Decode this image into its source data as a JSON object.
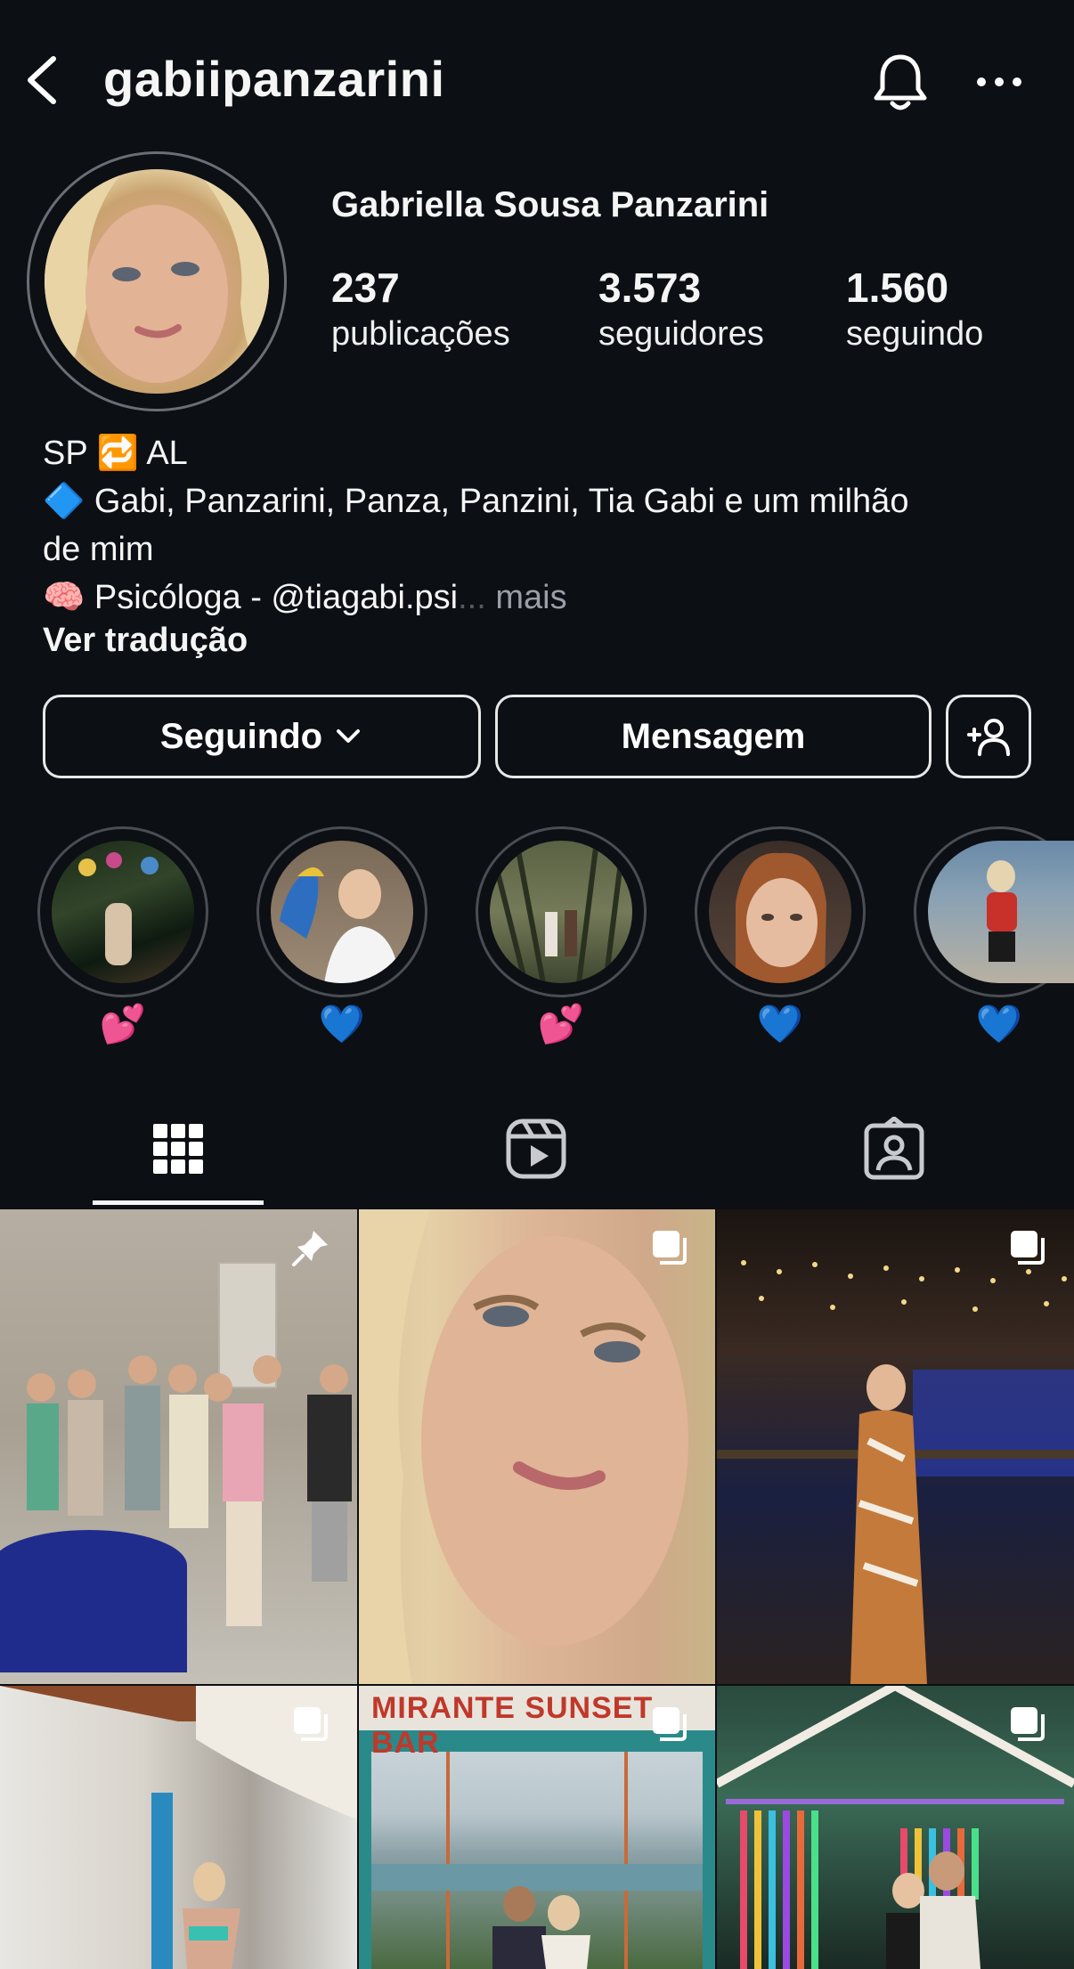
{
  "header": {
    "username": "gabiipanzarini",
    "back_icon": "chevron-left-icon",
    "bell_icon": "bell-icon",
    "more_icon": "more-horizontal-icon"
  },
  "profile": {
    "full_name": "Gabriella Sousa Panzarini",
    "stats": [
      {
        "value": "237",
        "label": "publicações"
      },
      {
        "value": "3.573",
        "label": "seguidores"
      },
      {
        "value": "1.560",
        "label": "seguindo"
      }
    ]
  },
  "bio": {
    "line1": "SP 🔁 AL",
    "line2": "🔷 Gabi, Panzarini, Panza, Panzini, Tia Gabi e um milhão",
    "line3": "de mim",
    "line4": "🧠 Psicóloga - @tiagabi.psi",
    "ellipsis": "...",
    "more": " mais",
    "translate": "Ver tradução"
  },
  "actions": {
    "following": "Seguindo",
    "message": "Mensagem",
    "add_icon": "add-person-icon"
  },
  "highlights": [
    {
      "label": "💕"
    },
    {
      "label": "💙"
    },
    {
      "label": "💕"
    },
    {
      "label": "💙"
    },
    {
      "label": "💙"
    }
  ],
  "tabs": [
    {
      "name": "grid",
      "icon": "grid-icon",
      "active": true
    },
    {
      "name": "reels",
      "icon": "reels-icon",
      "active": false
    },
    {
      "name": "tagged",
      "icon": "tagged-icon",
      "active": false
    }
  ],
  "posts": [
    {
      "badge": "pin-icon"
    },
    {
      "badge": "carousel-icon"
    },
    {
      "badge": "carousel-icon"
    },
    {
      "badge": "carousel-icon"
    },
    {
      "badge": "carousel-icon",
      "sign_text": "MIRANTE SUNSET BAR"
    },
    {
      "badge": "carousel-icon"
    }
  ],
  "colors": {
    "background": "#0c0f14",
    "text": "#f5f5f5",
    "muted": "#9a9ea6",
    "border": "#e8e8e8"
  }
}
